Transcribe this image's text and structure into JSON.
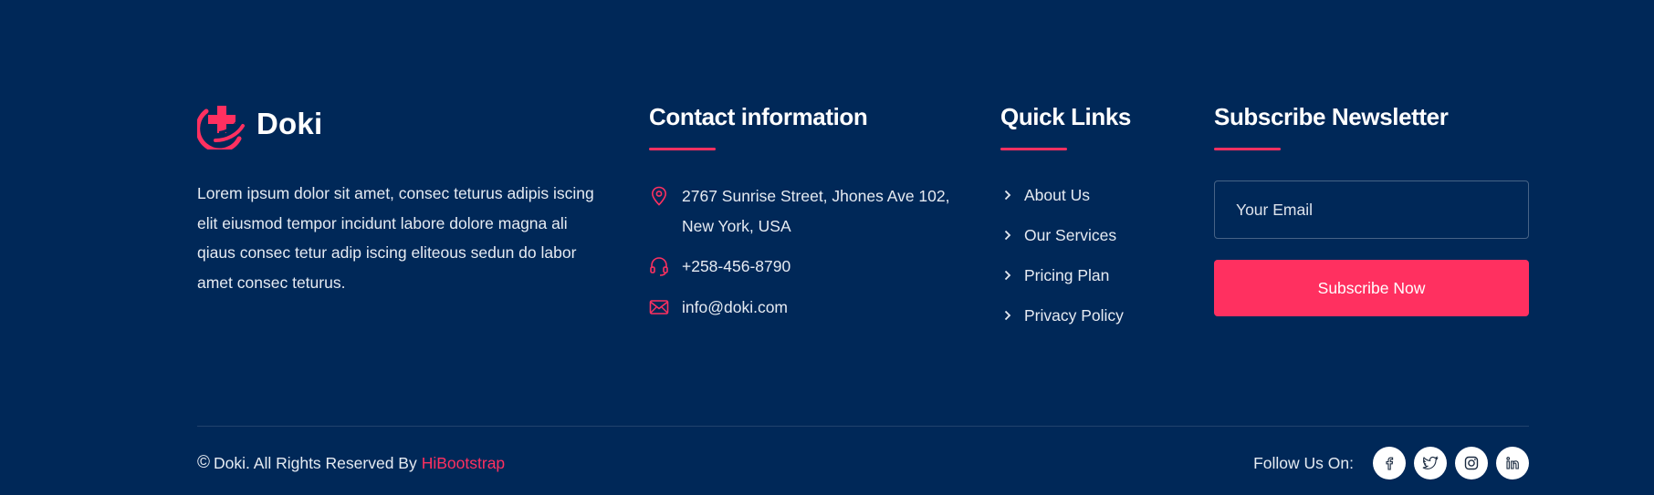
{
  "brand": {
    "name": "Doki",
    "about": "Lorem ipsum dolor sit amet, consec teturus adipis iscing elit eiusmod tempor incidunt labore dolore magna ali qiaus consec tetur adip iscing eliteous sedun do labor amet consec teturus.",
    "accent_color": "#ff3060",
    "background_color": "#002858"
  },
  "contact": {
    "heading": "Contact information",
    "items": [
      {
        "icon": "map-pin-icon",
        "text": "2767 Sunrise Street, Jhones Ave 102, New York, USA"
      },
      {
        "icon": "headset-icon",
        "text": "+258-456-8790"
      },
      {
        "icon": "envelope-icon",
        "text": "info@doki.com"
      }
    ]
  },
  "quick_links": {
    "heading": "Quick Links",
    "items": [
      {
        "label": "About Us"
      },
      {
        "label": "Our Services"
      },
      {
        "label": "Pricing Plan"
      },
      {
        "label": "Privacy Policy"
      }
    ]
  },
  "newsletter": {
    "heading": "Subscribe Newsletter",
    "input_placeholder": "Your Email",
    "input_value": "",
    "button_label": "Subscribe Now"
  },
  "footer": {
    "copyright_symbol": "©",
    "copyright_text": "Doki. All Rights Reserved By",
    "copyright_link": "HiBootstrap",
    "follow_label": "Follow Us On:",
    "socials": [
      {
        "name": "facebook-icon",
        "glyph": "f"
      },
      {
        "name": "twitter-icon",
        "glyph": "twitter"
      },
      {
        "name": "instagram-icon",
        "glyph": "instagram"
      },
      {
        "name": "linkedin-icon",
        "glyph": "in"
      }
    ]
  }
}
